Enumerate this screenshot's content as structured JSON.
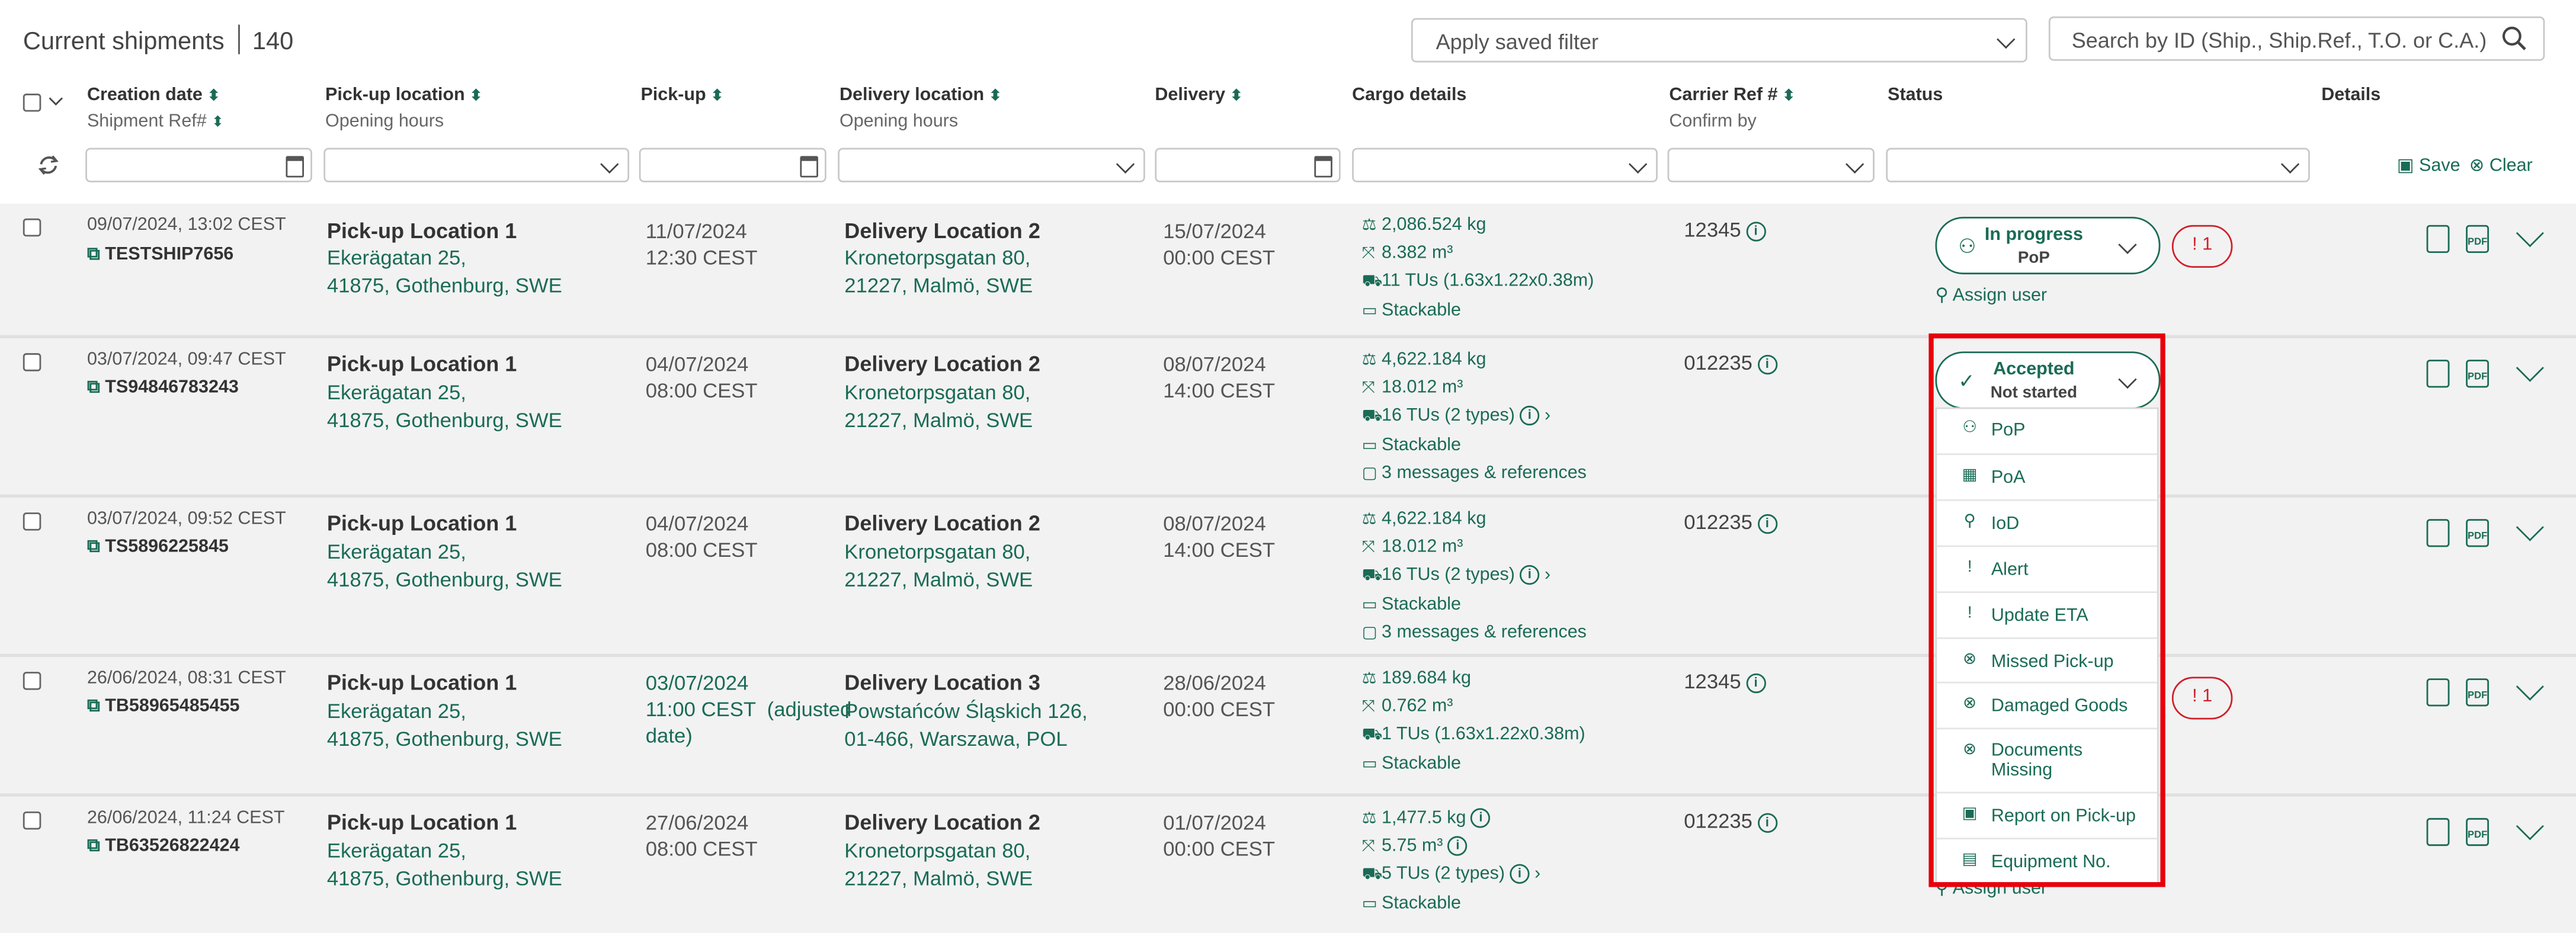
{
  "header": {
    "title": "Current shipments",
    "count": "140",
    "saved_filter_placeholder": "Apply saved filter",
    "search_placeholder": "Search by ID (Ship., Ship.Ref., T.O. or C.A.)"
  },
  "columns": {
    "creation_date": "Creation date",
    "shipment_ref": "Shipment Ref#",
    "pickup_location": "Pick-up location",
    "opening_hours": "Opening hours",
    "pickup": "Pick-up",
    "delivery_location": "Delivery location",
    "opening_hours_2": "Opening hours",
    "delivery": "Delivery",
    "cargo_details": "Cargo details",
    "carrier_ref": "Carrier Ref #",
    "confirm_by": "Confirm by",
    "status": "Status",
    "details": "Details"
  },
  "filters": {
    "save": "Save",
    "clear": "Clear"
  },
  "rows": [
    {
      "created": "09/07/2024, 13:02 CEST",
      "ref": "TESTSHIP7656",
      "pickup_name": "Pick-up Location 1",
      "pickup_addr1": "Ekerägatan 25,",
      "pickup_addr2": "41875, Gothenburg, SWE",
      "pickup_date": "11/07/2024",
      "pickup_time": "12:30 CEST",
      "delivery_name": "Delivery Location 2",
      "delivery_addr1": "Kronetorpsgatan 80,",
      "delivery_addr2": "21227, Malmö, SWE",
      "delivery_date": "15/07/2024",
      "delivery_time": "00:00 CEST",
      "weight": "2,086.524 kg",
      "volume": "8.382 m³",
      "tus": "11 TUs (1.63x1.22x0.38m)",
      "stackable": "Stackable",
      "carrier": "12345",
      "status_l1": "In progress",
      "status_l2": "PoP",
      "alert": "! 1",
      "assign": "Assign user"
    },
    {
      "created": "03/07/2024, 09:47 CEST",
      "ref": "TS94846783243",
      "pickup_name": "Pick-up Location 1",
      "pickup_addr1": "Ekerägatan 25,",
      "pickup_addr2": "41875, Gothenburg, SWE",
      "pickup_date": "04/07/2024",
      "pickup_time": "08:00 CEST",
      "delivery_name": "Delivery Location 2",
      "delivery_addr1": "Kronetorpsgatan 80,",
      "delivery_addr2": "21227, Malmö, SWE",
      "delivery_date": "08/07/2024",
      "delivery_time": "14:00 CEST",
      "weight": "4,622.184 kg",
      "volume": "18.012 m³",
      "tus": "16 TUs (2 types)",
      "stackable": "Stackable",
      "messages": "3 messages & references",
      "carrier": "012235",
      "status_l1": "Accepted",
      "status_l2": "Not started"
    },
    {
      "created": "03/07/2024, 09:52 CEST",
      "ref": "TS5896225845",
      "pickup_name": "Pick-up Location 1",
      "pickup_addr1": "Ekerägatan 25,",
      "pickup_addr2": "41875, Gothenburg, SWE",
      "pickup_date": "04/07/2024",
      "pickup_time": "08:00 CEST",
      "delivery_name": "Delivery Location 2",
      "delivery_addr1": "Kronetorpsgatan 80,",
      "delivery_addr2": "21227, Malmö, SWE",
      "delivery_date": "08/07/2024",
      "delivery_time": "14:00 CEST",
      "weight": "4,622.184 kg",
      "volume": "18.012 m³",
      "tus": "16 TUs (2 types)",
      "stackable": "Stackable",
      "messages": "3 messages & references",
      "carrier": "012235"
    },
    {
      "created": "26/06/2024, 08:31 CEST",
      "ref": "TB58965485455",
      "pickup_name": "Pick-up Location 1",
      "pickup_addr1": "Ekerägatan 25,",
      "pickup_addr2": "41875, Gothenburg, SWE",
      "pickup_date": "03/07/2024",
      "pickup_time": "11:00 CEST  (adjusted",
      "pickup_note": "date)",
      "delivery_name": "Delivery Location 3",
      "delivery_addr1": "Powstańców Śląskich 126,",
      "delivery_addr2": "01-466, Warszawa, POL",
      "delivery_date": "28/06/2024",
      "delivery_time": "00:00 CEST",
      "weight": "189.684 kg",
      "volume": "0.762 m³",
      "tus": "1 TUs (1.63x1.22x0.38m)",
      "stackable": "Stackable",
      "carrier": "12345",
      "alert": "! 1"
    },
    {
      "created": "26/06/2024, 11:24 CEST",
      "ref": "TB63526822424",
      "pickup_name": "Pick-up Location 1",
      "pickup_addr1": "Ekerägatan 25,",
      "pickup_addr2": "41875, Gothenburg, SWE",
      "pickup_date": "27/06/2024",
      "pickup_time": "08:00 CEST",
      "delivery_name": "Delivery Location 2",
      "delivery_addr1": "Kronetorpsgatan 80,",
      "delivery_addr2": "21227, Malmö, SWE",
      "delivery_date": "01/07/2024",
      "delivery_time": "00:00 CEST",
      "weight": "1,477.5 kg",
      "volume": "5.75 m³",
      "tus": "5 TUs (2 types)",
      "stackable": "Stackable",
      "carrier": "012235",
      "assign": "Assign user"
    }
  ],
  "status_menu": [
    "PoP",
    "PoA",
    "IoD",
    "Alert",
    "Update ETA",
    "Missed Pick-up",
    "Damaged Goods",
    "Documents Missing",
    "Report on Pick-up",
    "Equipment No."
  ],
  "accent_color": "#1a6b55",
  "highlight_color": "#e8000b"
}
